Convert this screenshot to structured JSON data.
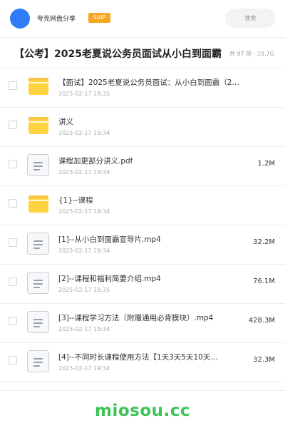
{
  "header": {
    "share_name": "夸克网盘分享",
    "badge": "SVIP",
    "search_placeholder": "搜索",
    "avatar_color": "#2f7cf6",
    "badge_color": "#f5a623"
  },
  "folder": {
    "title": "【公考】2025老夏说公务员面试从小白到面霸",
    "meta": "共 97 项 · 19.7G"
  },
  "items": [
    {
      "type": "folder",
      "icon": "folder-icon",
      "name": "【面试】2025老夏说公务员面试：从小白到面霸（2…",
      "date": "2025-02-17 19:35",
      "size": ""
    },
    {
      "type": "folder",
      "icon": "folder-icon",
      "name": "讲义",
      "date": "2025-02-17 19:34",
      "size": ""
    },
    {
      "type": "file",
      "icon": "file-icon",
      "name": "课程加更部分讲义.pdf",
      "date": "2025-02-17 19:34",
      "size": "1.2M"
    },
    {
      "type": "folder",
      "icon": "folder-icon",
      "name": "{1}--课程",
      "date": "2025-02-17 19:34",
      "size": ""
    },
    {
      "type": "file",
      "icon": "file-icon",
      "name": "[1]--从小白到面霸宣导片.mp4",
      "date": "2025-02-17 19:34",
      "size": "32.2M"
    },
    {
      "type": "file",
      "icon": "file-icon",
      "name": "[2]--课程和福利简要介绍.mp4",
      "date": "2025-02-17 19:35",
      "size": "76.1M"
    },
    {
      "type": "file",
      "icon": "file-icon",
      "name": "[3]--课程学习方法（附赠通用必背模块）.mp4",
      "date": "2025-02-17 19:34",
      "size": "428.3M"
    },
    {
      "type": "file",
      "icon": "file-icon",
      "name": "[4]--不同时长课程使用方法【1天3天5天10天…",
      "date": "2025-02-17 19:34",
      "size": "32.3M"
    }
  ],
  "watermark": "miosou.cc",
  "watermark_color": "#3cc255"
}
